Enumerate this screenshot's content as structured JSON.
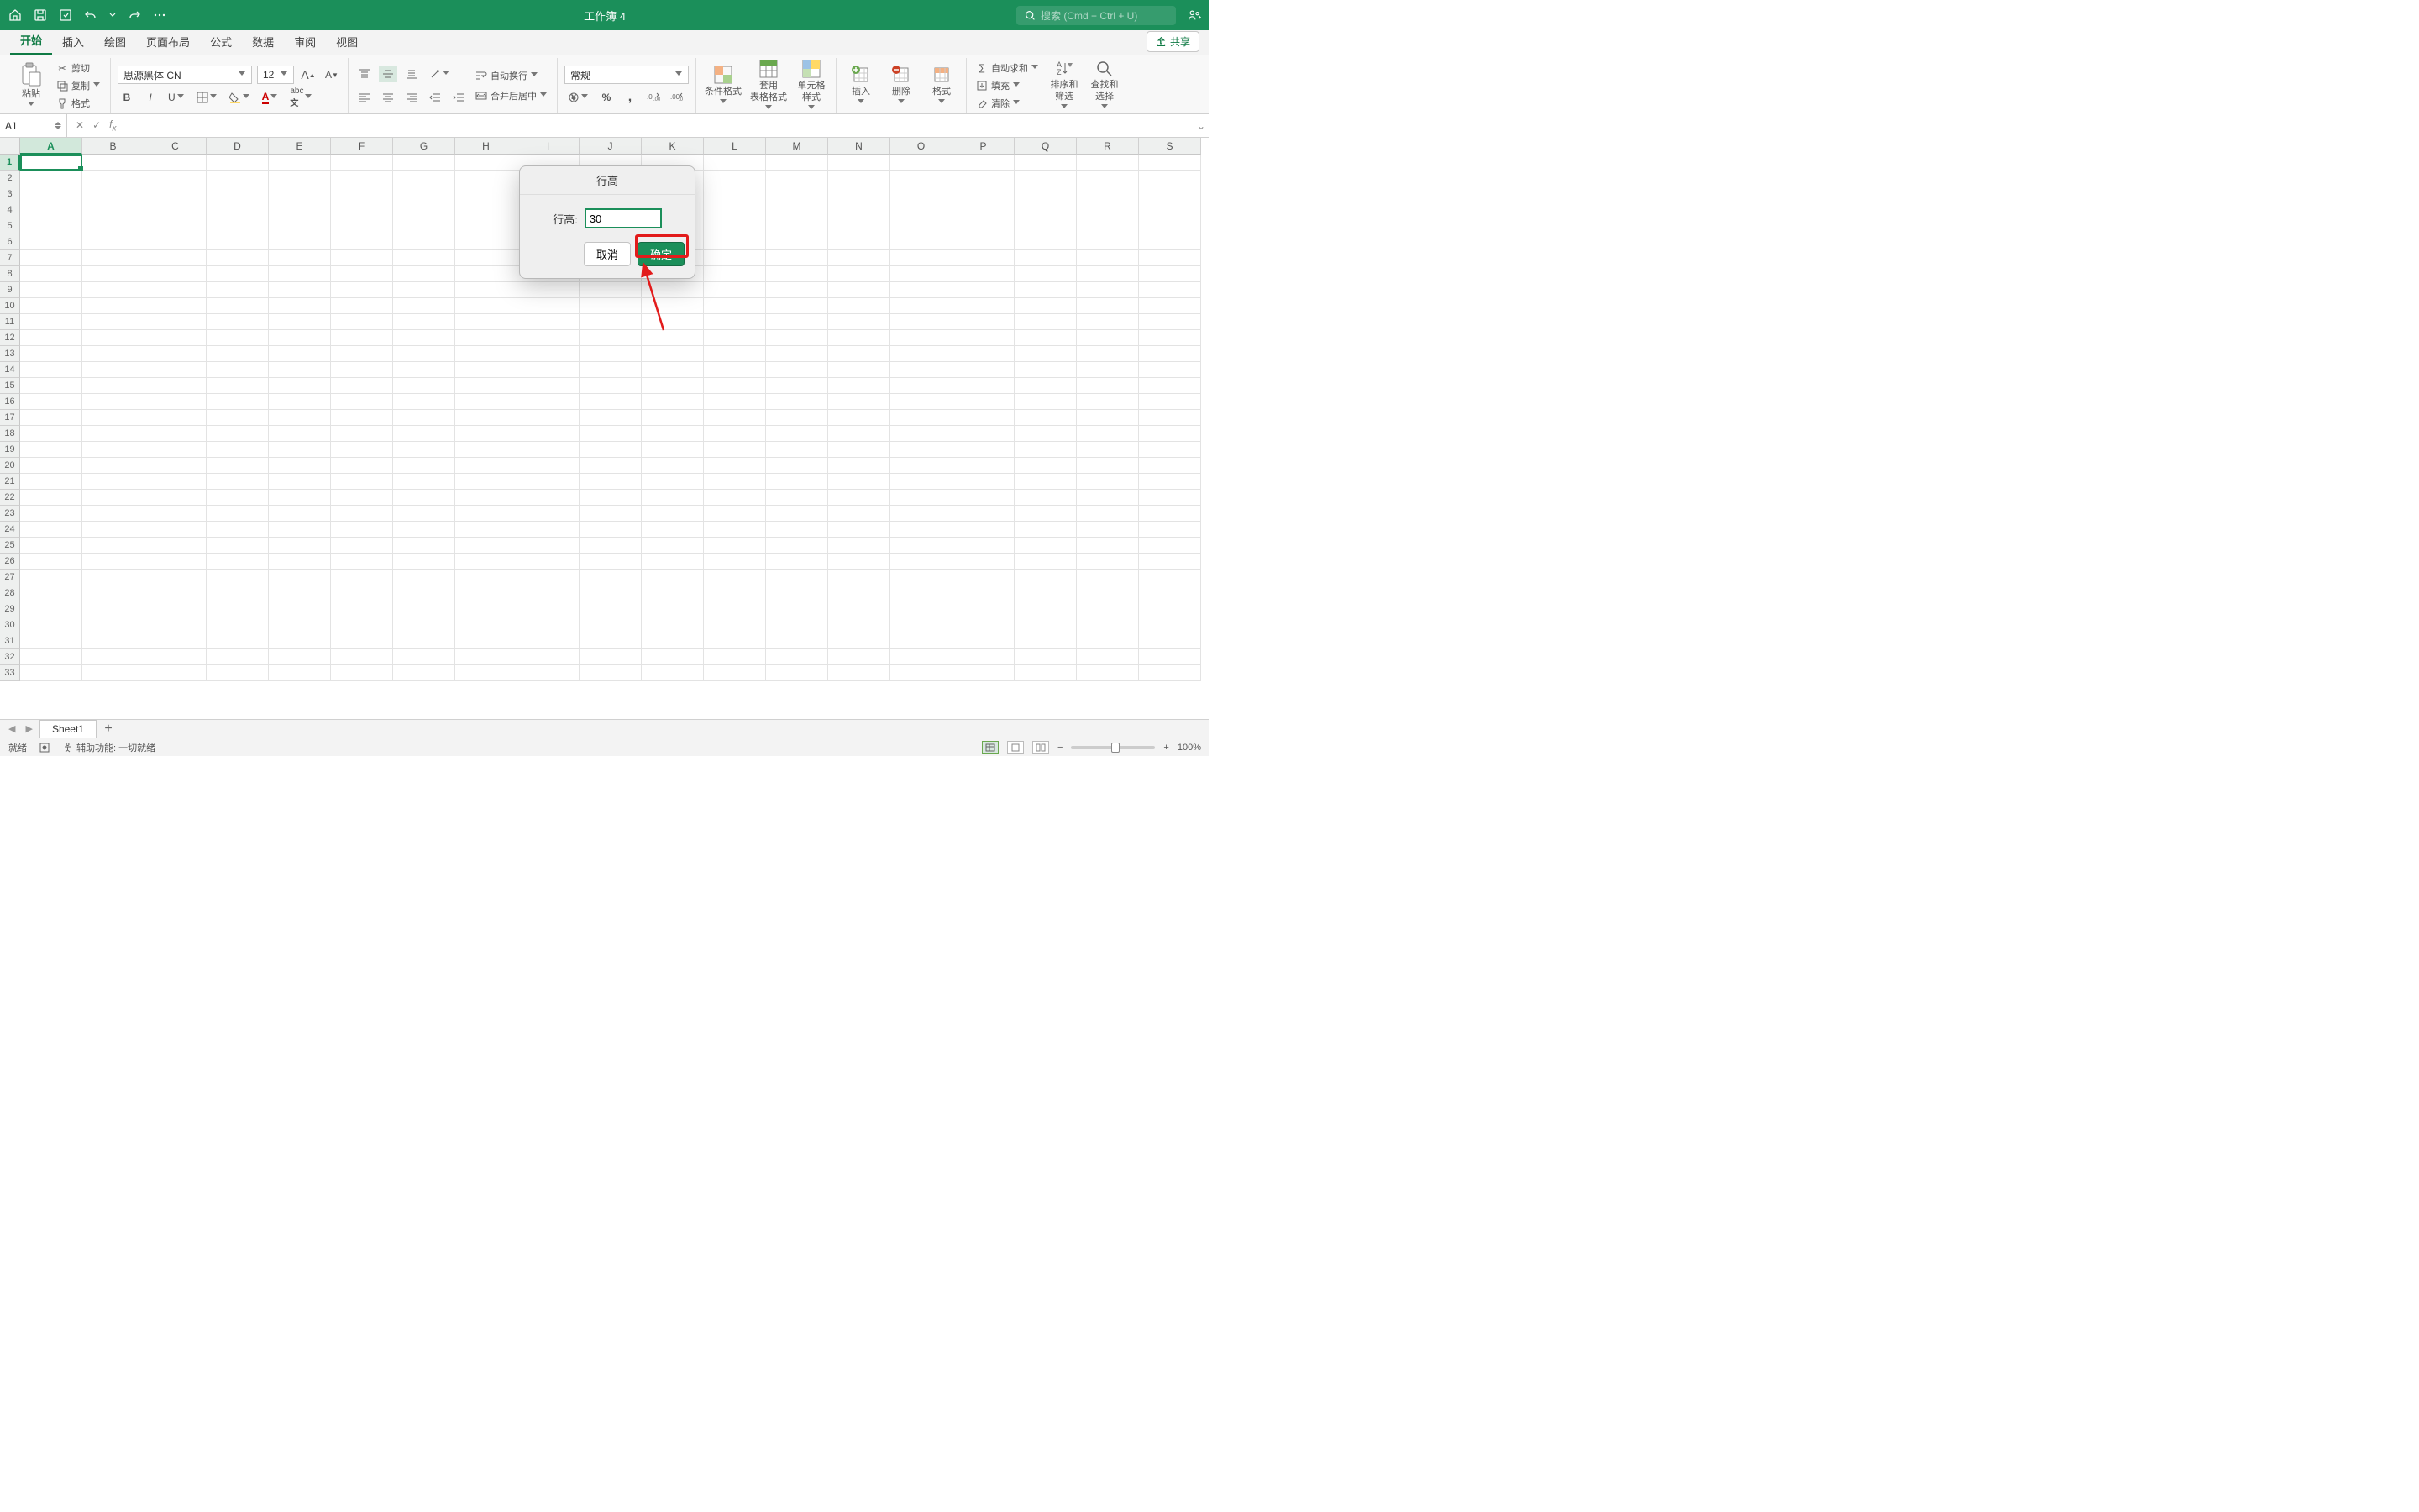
{
  "titlebar": {
    "title": "工作簿 4",
    "search_placeholder": "搜索 (Cmd + Ctrl + U)"
  },
  "tabs": {
    "items": [
      "开始",
      "插入",
      "绘图",
      "页面布局",
      "公式",
      "数据",
      "审阅",
      "视图"
    ],
    "active": 0,
    "share": "共享"
  },
  "ribbon": {
    "paste": "粘贴",
    "cut": "剪切",
    "copy": "复制",
    "format_painter": "格式",
    "font_name": "思源黑体 CN",
    "font_size": "12",
    "wrap_text": "自动换行",
    "merge_center": "合并后居中",
    "number_format": "常规",
    "cond_fmt": "条件格式",
    "table_fmt": "套用\n表格格式",
    "cell_styles": "单元格\n样式",
    "insert": "插入",
    "delete": "删除",
    "format": "格式",
    "autosum": "自动求和",
    "fill": "填充",
    "clear": "清除",
    "sort_filter": "排序和\n筛选",
    "find_select": "查找和\n选择"
  },
  "formula_bar": {
    "name_box": "A1"
  },
  "columns": [
    "A",
    "B",
    "C",
    "D",
    "E",
    "F",
    "G",
    "H",
    "I",
    "J",
    "K",
    "L",
    "M",
    "N",
    "O",
    "P",
    "Q",
    "R",
    "S"
  ],
  "rows": [
    "1",
    "2",
    "3",
    "4",
    "5",
    "6",
    "7",
    "8",
    "9",
    "10",
    "11",
    "12",
    "13",
    "14",
    "15",
    "16",
    "17",
    "18",
    "19",
    "20",
    "21",
    "22",
    "23",
    "24",
    "25",
    "26",
    "27",
    "28",
    "29",
    "30",
    "31",
    "32",
    "33"
  ],
  "dialog": {
    "title": "行高",
    "label": "行高:",
    "value": "30",
    "cancel": "取消",
    "ok": "确定"
  },
  "sheets": {
    "name": "Sheet1"
  },
  "statusbar": {
    "ready": "就绪",
    "accessibility": "辅助功能: 一切就绪",
    "zoom": "100%"
  }
}
